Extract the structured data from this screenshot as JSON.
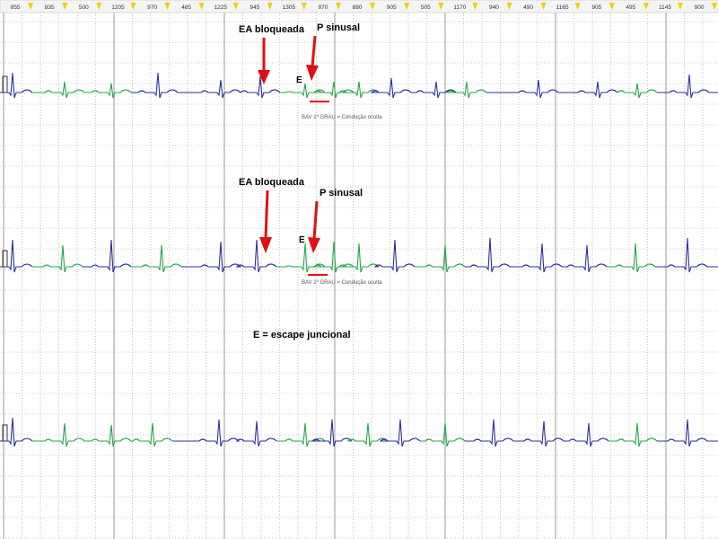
{
  "header": {
    "interval_values": [
      "855",
      "835",
      "500",
      "1205",
      "970",
      "485",
      "1225",
      "945",
      "1305",
      "870",
      "880",
      "905",
      "505",
      "1170",
      "940",
      "490",
      "1165",
      "905",
      "495",
      "1145",
      "900"
    ]
  },
  "annotations": {
    "strip1_blocked": "EA bloqueada",
    "strip1_p": "P sinusal",
    "strip1_e": "E",
    "strip1_caption": "BAV 1º GRAU = Condução oculta",
    "strip2_blocked": "EA bloqueada",
    "strip2_p": "P sinusal",
    "strip2_e": "E",
    "strip2_caption": "BAV 1º GRAU = Condução oculta",
    "legend": "E = escape juncional"
  },
  "colors": {
    "trace_blue": "#2b2f9e",
    "trace_green": "#1fa84a",
    "arrow": "#e01010",
    "grid": "#9a9a9a",
    "header_marker": "#f2d000"
  },
  "chart_data": {
    "type": "line",
    "title": "",
    "xlabel": "",
    "ylabel": "",
    "grid": true,
    "series_colors": [
      "blue",
      "green"
    ],
    "strips": [
      {
        "id": "strip-1",
        "events": [
          "EA bloqueada",
          "E",
          "P sinusal"
        ]
      },
      {
        "id": "strip-2",
        "events": [
          "EA bloqueada",
          "E",
          "P sinusal"
        ]
      },
      {
        "id": "strip-3",
        "events": []
      }
    ]
  }
}
